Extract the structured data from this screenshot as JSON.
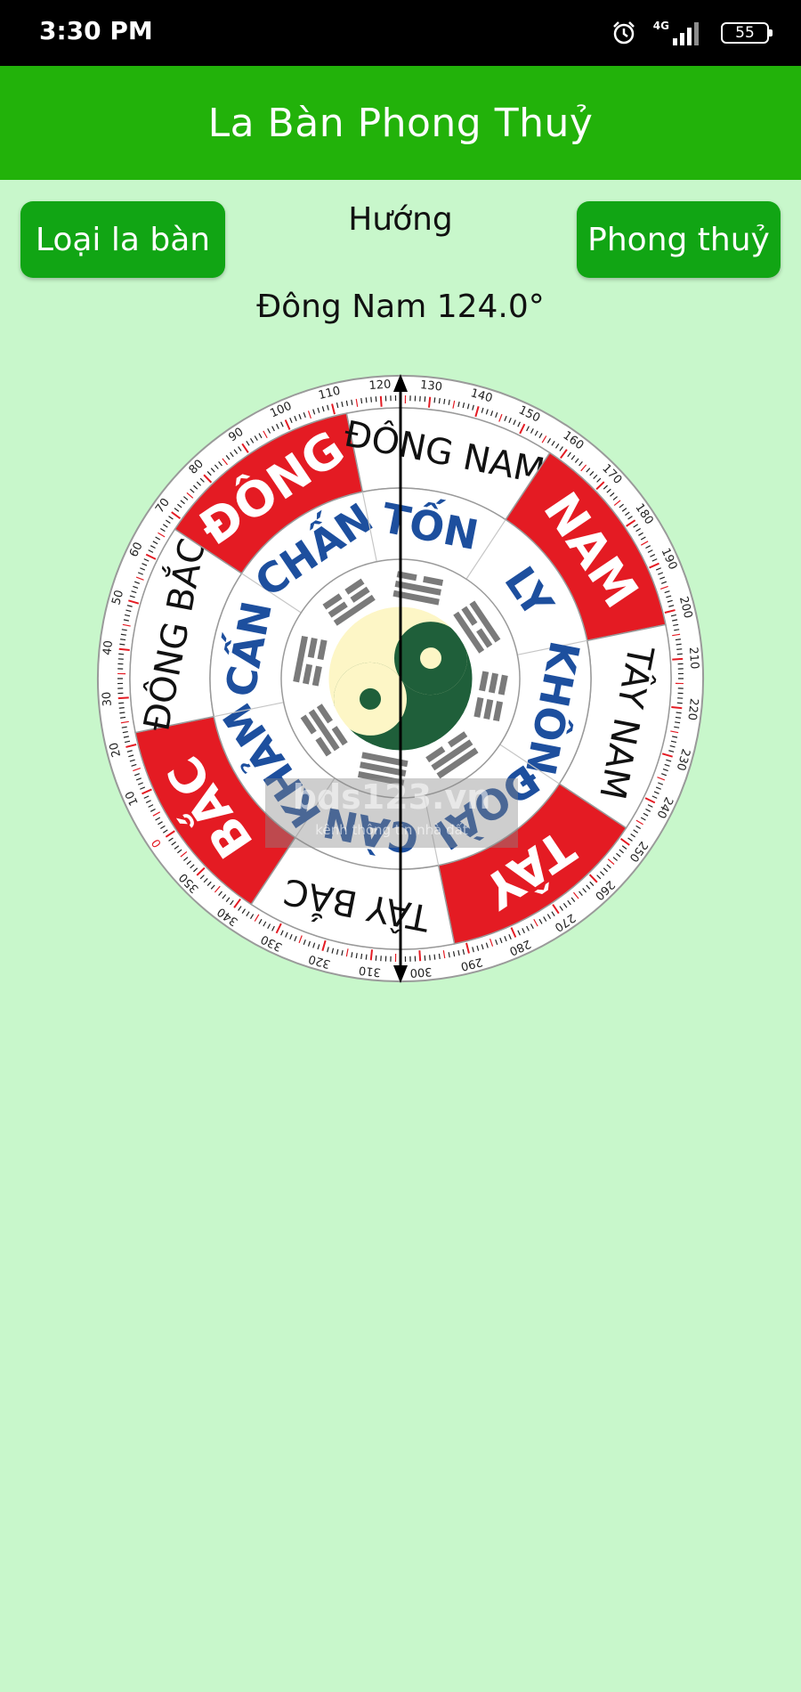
{
  "status": {
    "time": "3:30 PM",
    "network": "4G",
    "battery": "55"
  },
  "app_bar": {
    "title": "La Bàn Phong Thuỷ"
  },
  "buttons": {
    "compass_type": "Loại la bàn",
    "feng_shui": "Phong thuỷ"
  },
  "heading": {
    "label": "Hướng",
    "value": "Đông Nam 124.0°",
    "degrees": 124
  },
  "compass": {
    "directions": [
      "BẮC",
      "ĐÔNG BẮC",
      "ĐÔNG",
      "ĐÔNG NAM",
      "NAM",
      "TÂY NAM",
      "TÂY",
      "TÂY BẮC"
    ],
    "trigrams": [
      "KHẢM",
      "CẤN",
      "CHẤN",
      "TỐN",
      "LY",
      "KHÔN",
      "ĐOÀI",
      "CÀN"
    ],
    "colors": {
      "red": "#e41b23",
      "blue": "#1d4f9e",
      "green": "#1f5f3a",
      "cream": "#fdf6c6"
    }
  },
  "watermark": {
    "brand": "bds123.vn",
    "tagline": "kênh thông tin nhà đất"
  }
}
